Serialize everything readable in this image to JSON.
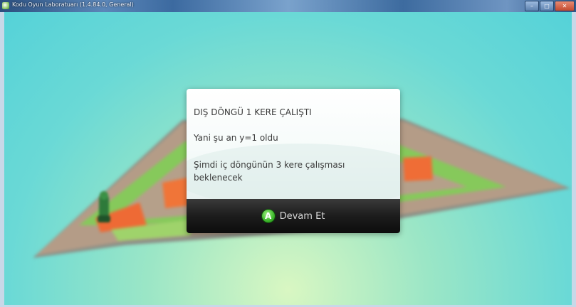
{
  "window": {
    "title": "Kodu Oyun Laboratuarı (1.4.84.0, General)",
    "controls": {
      "minimize": "–",
      "maximize": "□",
      "close": "✕"
    }
  },
  "dialog": {
    "line1": "DIŞ  DÖNGÜ 1 KERE ÇALIŞTI",
    "line2": "Yani şu an y=1 oldu",
    "line3": "Şimdi iç döngünün 3 kere çalışması beklenecek",
    "button": {
      "icon_letter": "A",
      "label": "Devam Et"
    }
  },
  "colors": {
    "sky_top": "#55d2d8",
    "sky_bottom": "#d9f7c2",
    "button_green": "#3cb62b",
    "dialog_bar": "#1c1c1c"
  },
  "icons": [
    "kodu-app-icon",
    "a-button-icon"
  ]
}
